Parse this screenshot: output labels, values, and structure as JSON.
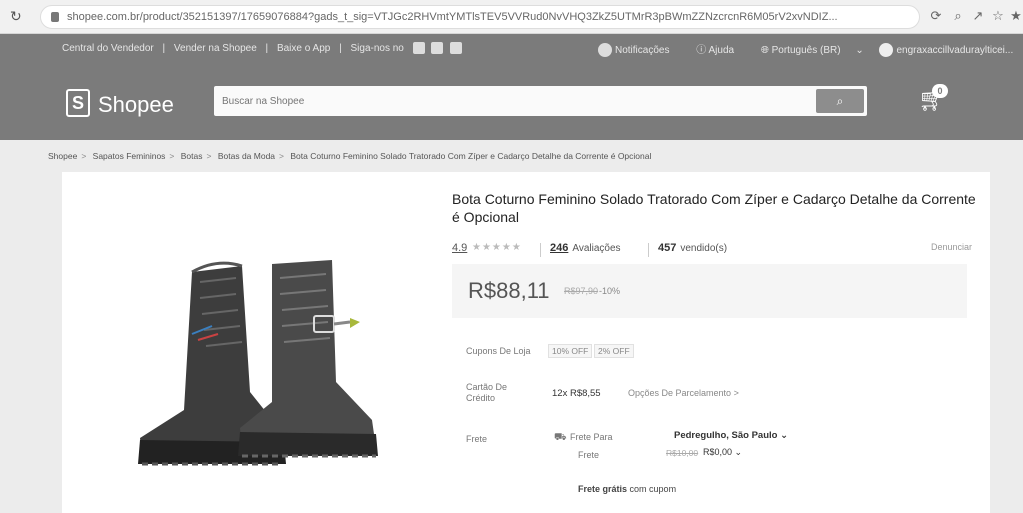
{
  "browser": {
    "url": "shopee.com.br/product/352151397/17659076884?gads_t_sig=VTJGc2RHVmtYMTlsTEV5VVRud0NvVHQ3ZkZ5UTMrR3pBWmZZNzcrcnR6M05rV2xvNDIZ..."
  },
  "top_nav": {
    "seller_center": "Central do Vendedor",
    "sell": "Vender na Shopee",
    "download_app": "Baixe o App",
    "follow_us": "Siga-nos no",
    "notifications": "Notificações",
    "help": "Ajuda",
    "language": "Português (BR)",
    "username": "engraxaccillvaduraylticei..."
  },
  "header": {
    "logo_text": "Shopee",
    "search_placeholder": "Buscar na Shopee",
    "cart_count": "0"
  },
  "breadcrumb": [
    "Shopee",
    "Sapatos Femininos",
    "Botas",
    "Botas da Moda",
    "Bota Coturno Feminino Solado Tratorado Com Zíper e Cadarço Detalhe da Corrente é Opcional"
  ],
  "product": {
    "title": "Bota Coturno Feminino Solado Tratorado Com Zíper e Cadarço Detalhe da Corrente é Opcional",
    "rating": "4.9",
    "rating_stars": 5,
    "reviews_count": "246",
    "reviews_label": "Avaliações",
    "sold_count": "457",
    "sold_label": "vendido(s)",
    "report_label": "Denunciar",
    "price": "R$88,11",
    "old_price": "R$97,90",
    "discount": "-10%",
    "coupon_label": "Cupons De Loja",
    "coupons": [
      "10% OFF",
      "2% OFF"
    ],
    "credit_label_1": "Cartão De",
    "credit_label_2": "Crédito",
    "installment": "12x R$8,55",
    "installment_link": "Opções De Parcelamento",
    "shipping_label": "Frete",
    "shipping_to": "Frete Para",
    "shipping_location": "Pedregulho, São Paulo",
    "shipping_cost_label": "Frete",
    "shipping_old": "R$10,00",
    "shipping_new": "R$0,00",
    "free_shipping_bold": "Frete grátis",
    "free_shipping_rest": "com cupom"
  }
}
